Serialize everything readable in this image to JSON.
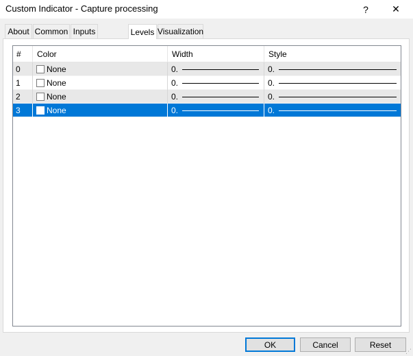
{
  "window": {
    "title": "Custom Indicator - Capture processing",
    "help_glyph": "?",
    "close_glyph": "✕"
  },
  "tabs": [
    {
      "label": "About",
      "active": false
    },
    {
      "label": "Common",
      "active": false
    },
    {
      "label": "Inputs",
      "active": false
    },
    {
      "label": "Levels",
      "active": true
    },
    {
      "label": "Visualization",
      "active": false
    }
  ],
  "grid": {
    "columns": [
      "#",
      "Color",
      "Width",
      "Style"
    ],
    "rows": [
      {
        "index": "0",
        "color": "None",
        "width": "0.",
        "style": "0."
      },
      {
        "index": "1",
        "color": "None",
        "width": "0.",
        "style": "0."
      },
      {
        "index": "2",
        "color": "None",
        "width": "0.",
        "style": "0."
      },
      {
        "index": "3",
        "color": "None",
        "width": "0.",
        "style": "0."
      }
    ],
    "selected_row": 3
  },
  "buttons": {
    "ok": "OK",
    "cancel": "Cancel",
    "reset": "Reset"
  },
  "colors": {
    "selection": "#0078d7",
    "alt_row": "#e8e8e8"
  }
}
